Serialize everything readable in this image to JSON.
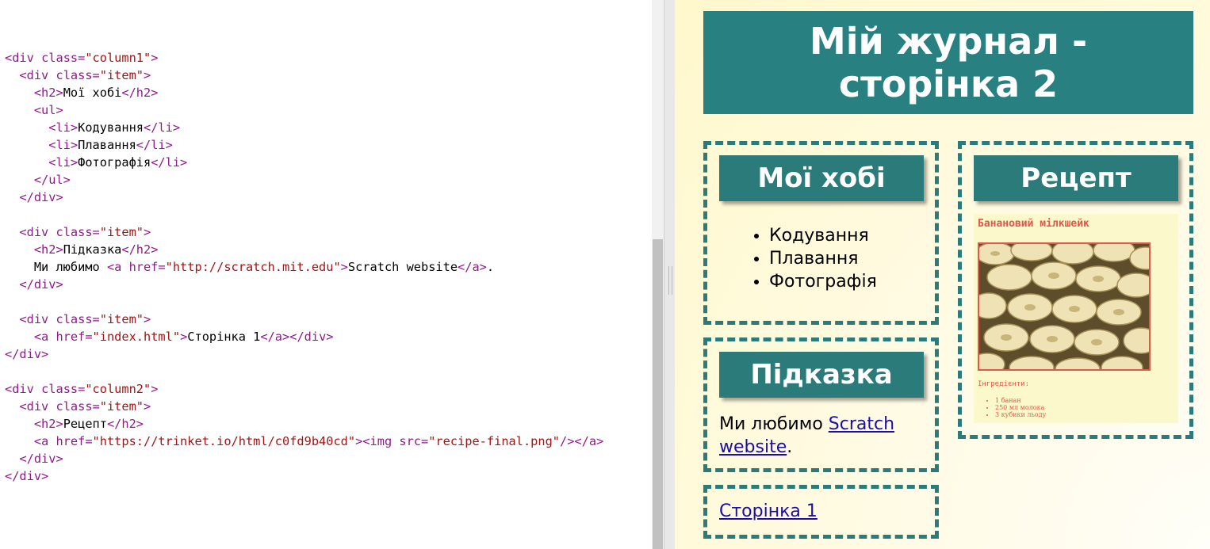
{
  "editor": {
    "lines": [
      [
        [
          "tag",
          "<div "
        ],
        [
          "attr",
          "class="
        ],
        [
          "str",
          "\"column1\""
        ],
        [
          "tag",
          ">"
        ]
      ],
      [
        [
          "txt",
          "  "
        ],
        [
          "tag",
          "<div "
        ],
        [
          "attr",
          "class="
        ],
        [
          "str",
          "\"item\""
        ],
        [
          "tag",
          ">"
        ]
      ],
      [
        [
          "txt",
          "    "
        ],
        [
          "tag",
          "<h2>"
        ],
        [
          "txt",
          "Мої хобі"
        ],
        [
          "tag",
          "</h2>"
        ]
      ],
      [
        [
          "txt",
          "    "
        ],
        [
          "tag",
          "<ul>"
        ]
      ],
      [
        [
          "txt",
          "      "
        ],
        [
          "tag",
          "<li>"
        ],
        [
          "txt",
          "Кодування"
        ],
        [
          "tag",
          "</li>"
        ]
      ],
      [
        [
          "txt",
          "      "
        ],
        [
          "tag",
          "<li>"
        ],
        [
          "txt",
          "Плавання"
        ],
        [
          "tag",
          "</li>"
        ]
      ],
      [
        [
          "txt",
          "      "
        ],
        [
          "tag",
          "<li>"
        ],
        [
          "txt",
          "Фотографія"
        ],
        [
          "tag",
          "</li>"
        ]
      ],
      [
        [
          "txt",
          "    "
        ],
        [
          "tag",
          "</ul>"
        ]
      ],
      [
        [
          "txt",
          "  "
        ],
        [
          "tag",
          "</div>"
        ]
      ],
      [
        [
          "txt",
          ""
        ]
      ],
      [
        [
          "txt",
          "  "
        ],
        [
          "tag",
          "<div "
        ],
        [
          "attr",
          "class="
        ],
        [
          "str",
          "\"item\""
        ],
        [
          "tag",
          ">"
        ]
      ],
      [
        [
          "txt",
          "    "
        ],
        [
          "tag",
          "<h2>"
        ],
        [
          "txt",
          "Підказка"
        ],
        [
          "tag",
          "</h2>"
        ]
      ],
      [
        [
          "txt",
          "    Ми любимо "
        ],
        [
          "tag",
          "<a "
        ],
        [
          "attr",
          "href="
        ],
        [
          "str",
          "\"http://scratch.mit.edu\""
        ],
        [
          "tag",
          ">"
        ],
        [
          "txt",
          "Scratch website"
        ],
        [
          "tag",
          "</a>"
        ],
        [
          "txt",
          "."
        ]
      ],
      [
        [
          "txt",
          "  "
        ],
        [
          "tag",
          "</div>"
        ]
      ],
      [
        [
          "txt",
          ""
        ]
      ],
      [
        [
          "txt",
          "  "
        ],
        [
          "tag",
          "<div "
        ],
        [
          "attr",
          "class="
        ],
        [
          "str",
          "\"item\""
        ],
        [
          "tag",
          ">"
        ]
      ],
      [
        [
          "txt",
          "    "
        ],
        [
          "tag",
          "<a "
        ],
        [
          "attr",
          "href="
        ],
        [
          "str",
          "\"index.html\""
        ],
        [
          "tag",
          ">"
        ],
        [
          "txt",
          "Сторінка 1"
        ],
        [
          "tag",
          "</a></div>"
        ]
      ],
      [
        [
          "tag",
          "</div>"
        ]
      ],
      [
        [
          "txt",
          ""
        ]
      ],
      [
        [
          "tag",
          "<div "
        ],
        [
          "attr",
          "class="
        ],
        [
          "str",
          "\"column2\""
        ],
        [
          "tag",
          ">"
        ]
      ],
      [
        [
          "txt",
          "  "
        ],
        [
          "tag",
          "<div "
        ],
        [
          "attr",
          "class="
        ],
        [
          "str",
          "\"item\""
        ],
        [
          "tag",
          ">"
        ]
      ],
      [
        [
          "txt",
          "    "
        ],
        [
          "tag",
          "<h2>"
        ],
        [
          "txt",
          "Рецепт"
        ],
        [
          "tag",
          "</h2>"
        ]
      ],
      [
        [
          "txt",
          "    "
        ],
        [
          "tag",
          "<a "
        ],
        [
          "attr",
          "href="
        ],
        [
          "str",
          "\"https://trinket.io/html/c0fd9b40cd\""
        ],
        [
          "tag",
          ">"
        ],
        [
          "tag",
          "<img "
        ],
        [
          "attr",
          "src="
        ],
        [
          "str",
          "\"recipe-final.png\""
        ],
        [
          "tag",
          "/></a>"
        ]
      ],
      [
        [
          "txt",
          "  "
        ],
        [
          "tag",
          "</div>"
        ]
      ],
      [
        [
          "tag",
          "</div>"
        ]
      ]
    ]
  },
  "preview": {
    "title": "Мій журнал - сторінка 2",
    "hobbies": {
      "heading": "Мої хобі",
      "items": [
        "Кодування",
        "Плавання",
        "Фотографія"
      ]
    },
    "tip": {
      "heading": "Підказка",
      "text_before": "Ми любимо ",
      "link_text": "Scratch website",
      "text_after": "."
    },
    "page1_link": "Сторінка 1",
    "recipe": {
      "heading": "Рецепт",
      "image_title": "Банановий мілкшейк",
      "ingredients_label": "Інгредієнти:",
      "ingredients": [
        "1 банан",
        "250 мл молока",
        "3 кубики льоду"
      ]
    }
  },
  "colors": {
    "accent": "#288080",
    "code_tag": "#8e1b8a",
    "code_string": "#a31515",
    "link": "#1a0dab",
    "recipe_text": "#e2574a"
  },
  "icons": [
    "splitter-grip-icon"
  ]
}
